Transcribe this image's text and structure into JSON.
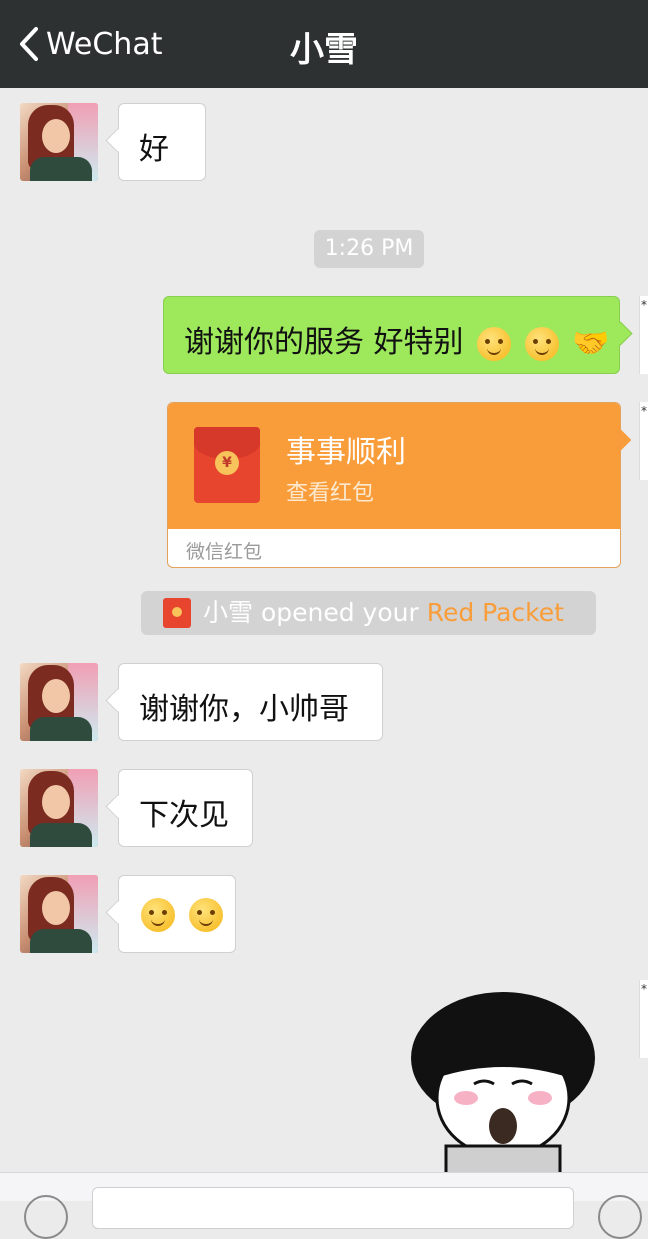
{
  "header": {
    "back_label": "WeChat",
    "title": "小雪"
  },
  "messages": [
    {
      "side": "left",
      "text": "好"
    },
    {
      "type": "timestamp",
      "text": "1:26 PM"
    },
    {
      "side": "right",
      "text": "谢谢你的服务 好特别",
      "emoji": [
        "smiling-face-icon",
        "smiling-face-icon",
        "handshake-icon"
      ]
    },
    {
      "type": "red_packet",
      "title": "事事顺利",
      "subtitle": "查看红包",
      "footer": "微信红包"
    },
    {
      "type": "notice",
      "name": "小雪",
      "middle": " opened your ",
      "link": "Red Packet"
    },
    {
      "side": "left",
      "text": "谢谢你，小帅哥"
    },
    {
      "side": "left",
      "text": "下次见"
    },
    {
      "side": "left",
      "emoji": [
        "smiling-face-icon",
        "smiling-face-icon"
      ]
    },
    {
      "side": "right",
      "type": "sticker",
      "icon": "cartoon-sticker-icon"
    }
  ],
  "colors": {
    "header_bg": "#2e3132",
    "chat_bg": "#ebebeb",
    "sent_bubble": "#9ee85c",
    "red_packet": "#f99d3a",
    "link_orange": "#f99d3a"
  }
}
